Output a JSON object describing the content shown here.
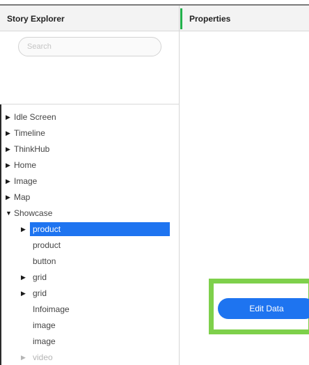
{
  "explorer": {
    "title": "Story Explorer",
    "search_placeholder": "Search",
    "items": [
      {
        "label": "Idle Screen",
        "arrow": "▶"
      },
      {
        "label": "Timeline",
        "arrow": "▶"
      },
      {
        "label": "ThinkHub",
        "arrow": "▶"
      },
      {
        "label": "Home",
        "arrow": "▶"
      },
      {
        "label": "Image",
        "arrow": "▶"
      },
      {
        "label": "Map",
        "arrow": "▶"
      },
      {
        "label": "Showcase",
        "arrow": "▼"
      },
      {
        "label": "product",
        "arrow": "▶"
      },
      {
        "label": "product",
        "arrow": ""
      },
      {
        "label": "button",
        "arrow": ""
      },
      {
        "label": "grid",
        "arrow": "▶"
      },
      {
        "label": "grid",
        "arrow": "▶"
      },
      {
        "label": "Infoimage",
        "arrow": ""
      },
      {
        "label": "image",
        "arrow": ""
      },
      {
        "label": "image",
        "arrow": ""
      },
      {
        "label": "video",
        "arrow": "▶"
      }
    ]
  },
  "properties": {
    "title": "Properties",
    "edit_data_label": "Edit Data"
  },
  "colors": {
    "selection": "#1e74f0",
    "accent": "#22b14c",
    "highlight": "#7ed04b"
  }
}
